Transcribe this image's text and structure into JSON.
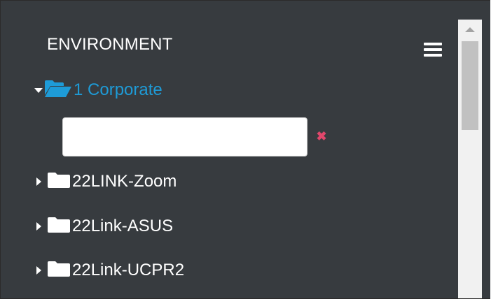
{
  "header": {
    "title": "ENVIRONMENT",
    "menu_icon": "hamburger-menu-icon"
  },
  "tree": {
    "root": {
      "label": "1 Corporate",
      "expanded": true,
      "icon": "folder-open-icon",
      "color": "#1e9bd7"
    },
    "new_folder_input": {
      "value": "",
      "placeholder": ""
    },
    "clear_icon": "close-icon",
    "children": [
      {
        "label": "22LINK-Zoom",
        "icon": "folder-icon",
        "expanded": false
      },
      {
        "label": "22Link-ASUS",
        "icon": "folder-icon",
        "expanded": false
      },
      {
        "label": "22Link-UCPR2",
        "icon": "folder-icon",
        "expanded": false
      }
    ]
  },
  "colors": {
    "panel_bg": "#373b3f",
    "accent": "#1e9bd7",
    "clear": "#e0476b"
  }
}
